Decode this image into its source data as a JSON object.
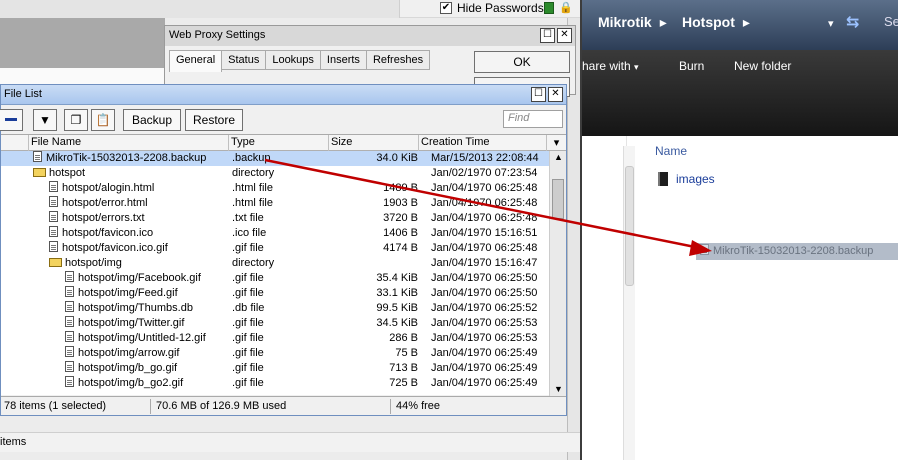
{
  "top_bar": {
    "hide_passwords_label": "Hide Passwords",
    "hide_passwords_checked": true,
    "lock_icon": "lock-icon"
  },
  "web_proxy": {
    "title": "Web Proxy Settings",
    "tabs": [
      "General",
      "Status",
      "Lookups",
      "Inserts",
      "Refreshes"
    ],
    "ok_label": "OK"
  },
  "file_list": {
    "title": "File List",
    "toolbar": {
      "backup_label": "Backup",
      "restore_label": "Restore",
      "find_placeholder": "Find"
    },
    "columns": [
      "File Name",
      "Type",
      "Size",
      "Creation Time"
    ],
    "rows": [
      {
        "name": "MikroTik-15032013-2208.backup",
        "type": ".backup",
        "size": "34.0 KiB",
        "date": "Mar/15/2013 22:08:44",
        "icon": "file",
        "indent": 1,
        "selected": true
      },
      {
        "name": "hotspot",
        "type": "directory",
        "size": "",
        "date": "Jan/02/1970 07:23:54",
        "icon": "folder",
        "indent": 1
      },
      {
        "name": "hotspot/alogin.html",
        "type": ".html file",
        "size": "1489 B",
        "date": "Jan/04/1970 06:25:48",
        "icon": "file",
        "indent": 2
      },
      {
        "name": "hotspot/error.html",
        "type": ".html file",
        "size": "1903 B",
        "date": "Jan/04/1970 06:25:48",
        "icon": "file",
        "indent": 2
      },
      {
        "name": "hotspot/errors.txt",
        "type": ".txt file",
        "size": "3720 B",
        "date": "Jan/04/1970 06:25:48",
        "icon": "file",
        "indent": 2
      },
      {
        "name": "hotspot/favicon.ico",
        "type": ".ico file",
        "size": "1406 B",
        "date": "Jan/04/1970 15:16:51",
        "icon": "file",
        "indent": 2
      },
      {
        "name": "hotspot/favicon.ico.gif",
        "type": ".gif file",
        "size": "4174 B",
        "date": "Jan/04/1970 06:25:48",
        "icon": "file",
        "indent": 2
      },
      {
        "name": "hotspot/img",
        "type": "directory",
        "size": "",
        "date": "Jan/04/1970 15:16:47",
        "icon": "folder",
        "indent": 2
      },
      {
        "name": "hotspot/img/Facebook.gif",
        "type": ".gif file",
        "size": "35.4 KiB",
        "date": "Jan/04/1970 06:25:50",
        "icon": "file",
        "indent": 3
      },
      {
        "name": "hotspot/img/Feed.gif",
        "type": ".gif file",
        "size": "33.1 KiB",
        "date": "Jan/04/1970 06:25:50",
        "icon": "file",
        "indent": 3
      },
      {
        "name": "hotspot/img/Thumbs.db",
        "type": ".db file",
        "size": "99.5 KiB",
        "date": "Jan/04/1970 06:25:52",
        "icon": "file",
        "indent": 3
      },
      {
        "name": "hotspot/img/Twitter.gif",
        "type": ".gif file",
        "size": "34.5 KiB",
        "date": "Jan/04/1970 06:25:53",
        "icon": "file",
        "indent": 3
      },
      {
        "name": "hotspot/img/Untitled-12.gif",
        "type": ".gif file",
        "size": "286 B",
        "date": "Jan/04/1970 06:25:53",
        "icon": "file",
        "indent": 3
      },
      {
        "name": "hotspot/img/arrow.gif",
        "type": ".gif file",
        "size": "75 B",
        "date": "Jan/04/1970 06:25:49",
        "icon": "file",
        "indent": 3
      },
      {
        "name": "hotspot/img/b_go.gif",
        "type": ".gif file",
        "size": "713 B",
        "date": "Jan/04/1970 06:25:49",
        "icon": "file",
        "indent": 3
      },
      {
        "name": "hotspot/img/b_go2.gif",
        "type": ".gif file",
        "size": "725 B",
        "date": "Jan/04/1970 06:25:49",
        "icon": "file",
        "indent": 3
      }
    ],
    "status": {
      "items": "78 items (1 selected)",
      "usage": "70.6 MB of 126.9 MB used",
      "free": "44% free"
    }
  },
  "left_status": {
    "text": "items"
  },
  "explorer": {
    "breadcrumb": [
      "Mikrotik",
      "Hotspot"
    ],
    "search_hint": "Se",
    "commands": [
      "hare with",
      "Burn",
      "New folder"
    ],
    "column_name": "Name",
    "items": [
      {
        "name": "images",
        "icon": "folder-icon"
      }
    ],
    "drag_label": "MikroTik-15032013-2208.backup"
  },
  "colors": {
    "arrow": "#c00000",
    "selection": "#c0d8f8",
    "title_blue": "#a9c6ee"
  }
}
